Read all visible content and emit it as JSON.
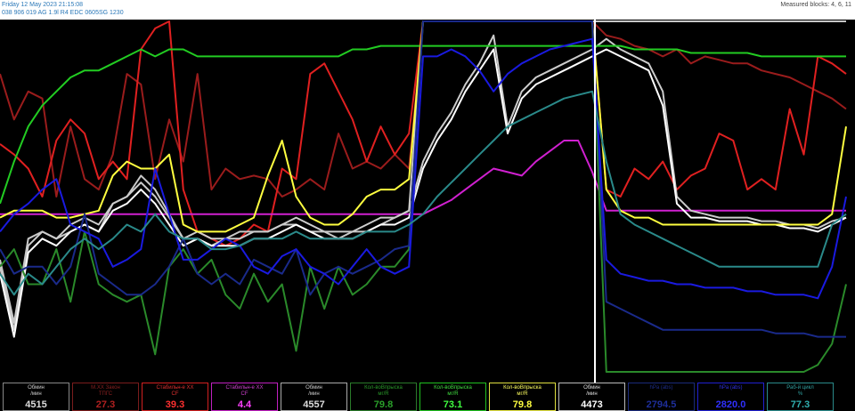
{
  "header": {
    "line1": "Friday 12 May 2023 21:15:08",
    "line2": "038 906 019 AG  1.9l R4 EDC 0605SG  1230",
    "blocks": "Measured blocks: 4, 6, 11"
  },
  "chart_data": {
    "type": "line",
    "ylim": [
      0,
      100
    ],
    "xlim": [
      0,
      60
    ],
    "cursor_x": 42,
    "series": [
      {
        "color": "#9a1c1c",
        "values": [
          85,
          72,
          80,
          78,
          50,
          70,
          55,
          52,
          62,
          85,
          82,
          55,
          72,
          60,
          85,
          52,
          58,
          55,
          56,
          55,
          50,
          52,
          55,
          52,
          68,
          58,
          60,
          58,
          62,
          58,
          100,
          100,
          100,
          100,
          100,
          100,
          100,
          100,
          100,
          100,
          100,
          100,
          100,
          96,
          95,
          93,
          92,
          90,
          92,
          88,
          90,
          89,
          88,
          88,
          86,
          85,
          84,
          82,
          80,
          78,
          75
        ]
      },
      {
        "color": "#e02020",
        "values": [
          65,
          62,
          58,
          50,
          66,
          72,
          68,
          55,
          60,
          55,
          92,
          98,
          100,
          52,
          40,
          38,
          36,
          38,
          42,
          40,
          58,
          55,
          85,
          88,
          80,
          72,
          60,
          70,
          62,
          68,
          100,
          100,
          100,
          100,
          100,
          100,
          100,
          100,
          100,
          100,
          100,
          100,
          100,
          52,
          50,
          58,
          55,
          60,
          52,
          56,
          58,
          68,
          66,
          52,
          55,
          52,
          75,
          62,
          90,
          88,
          85
        ]
      },
      {
        "color": "#d020d0",
        "values": [
          45,
          45,
          45,
          45,
          45,
          45,
          45,
          45,
          45,
          45,
          45,
          45,
          45,
          45,
          45,
          45,
          45,
          45,
          45,
          45,
          45,
          45,
          45,
          45,
          45,
          45,
          45,
          45,
          45,
          45,
          45,
          47,
          49,
          52,
          55,
          58,
          57,
          56,
          60,
          63,
          66,
          66,
          57,
          46,
          46,
          46,
          46,
          46,
          46,
          46,
          46,
          46,
          46,
          46,
          46,
          46,
          46,
          46,
          46,
          46,
          46
        ]
      },
      {
        "color": "#c8c8c8",
        "values": [
          32,
          14,
          38,
          40,
          38,
          40,
          42,
          40,
          48,
          50,
          56,
          52,
          45,
          38,
          38,
          36,
          38,
          40,
          40,
          40,
          42,
          42,
          40,
          40,
          38,
          40,
          40,
          42,
          44,
          46,
          100,
          100,
          100,
          100,
          100,
          100,
          100,
          100,
          100,
          100,
          100,
          100,
          100,
          100,
          100,
          100,
          100,
          100,
          100,
          100,
          100,
          100,
          100,
          100,
          100,
          100,
          100,
          100,
          100,
          100,
          100
        ]
      },
      {
        "color": "#cccccc",
        "values": [
          30,
          12,
          36,
          40,
          38,
          42,
          44,
          42,
          48,
          50,
          54,
          50,
          44,
          38,
          40,
          38,
          38,
          38,
          40,
          40,
          42,
          44,
          42,
          40,
          40,
          40,
          42,
          44,
          44,
          46,
          60,
          68,
          74,
          82,
          88,
          96,
          70,
          80,
          84,
          86,
          88,
          90,
          92,
          95,
          92,
          90,
          88,
          80,
          50,
          46,
          45,
          44,
          44,
          44,
          43,
          43,
          42,
          42,
          41,
          43,
          44
        ]
      },
      {
        "color": "#ffffff",
        "values": [
          28,
          10,
          34,
          38,
          36,
          40,
          42,
          40,
          46,
          48,
          52,
          48,
          42,
          36,
          38,
          36,
          36,
          36,
          38,
          38,
          40,
          42,
          40,
          38,
          38,
          38,
          40,
          42,
          42,
          44,
          58,
          66,
          72,
          80,
          86,
          92,
          68,
          78,
          82,
          84,
          86,
          88,
          90,
          92,
          90,
          88,
          86,
          76,
          48,
          44,
          44,
          43,
          43,
          43,
          42,
          42,
          41,
          41,
          40,
          42,
          44
        ]
      },
      {
        "color": "#2a8a2a",
        "values": [
          30,
          35,
          25,
          25,
          35,
          20,
          40,
          25,
          22,
          20,
          22,
          5,
          30,
          35,
          28,
          32,
          22,
          18,
          28,
          20,
          25,
          6,
          30,
          18,
          30,
          22,
          25,
          30,
          30,
          35,
          100,
          100,
          100,
          100,
          100,
          100,
          100,
          100,
          100,
          100,
          100,
          100,
          100,
          0,
          0,
          0,
          0,
          0,
          0,
          0,
          0,
          0,
          0,
          0,
          0,
          0,
          0,
          0,
          2,
          8,
          25
        ]
      },
      {
        "color": "#22cc22",
        "values": [
          48,
          60,
          70,
          76,
          80,
          84,
          86,
          86,
          88,
          90,
          92,
          90,
          92,
          92,
          90,
          90,
          90,
          90,
          90,
          90,
          90,
          90,
          90,
          90,
          90,
          92,
          92,
          93,
          93,
          93,
          93,
          93,
          93,
          93,
          93,
          93,
          93,
          93,
          93,
          93,
          93,
          93,
          93,
          93,
          93,
          92,
          92,
          92,
          92,
          91,
          91,
          91,
          91,
          91,
          90,
          90,
          90,
          90,
          90,
          90,
          90
        ]
      },
      {
        "color": "#ffff40",
        "values": [
          44,
          46,
          46,
          46,
          44,
          44,
          45,
          46,
          56,
          60,
          58,
          58,
          62,
          42,
          40,
          40,
          40,
          42,
          44,
          56,
          66,
          50,
          44,
          42,
          42,
          45,
          50,
          52,
          52,
          55,
          100,
          100,
          100,
          100,
          100,
          100,
          100,
          100,
          100,
          100,
          100,
          100,
          100,
          52,
          46,
          44,
          44,
          42,
          42,
          42,
          42,
          42,
          42,
          42,
          42,
          42,
          42,
          42,
          42,
          45,
          70
        ]
      },
      {
        "color": "#1a2a8a",
        "values": [
          35,
          28,
          30,
          30,
          25,
          30,
          45,
          28,
          25,
          22,
          22,
          25,
          30,
          38,
          28,
          25,
          28,
          25,
          32,
          30,
          28,
          35,
          22,
          28,
          30,
          28,
          30,
          32,
          35,
          36,
          100,
          100,
          100,
          100,
          100,
          100,
          100,
          100,
          100,
          100,
          100,
          100,
          100,
          20,
          18,
          16,
          14,
          12,
          12,
          12,
          12,
          12,
          12,
          12,
          12,
          11,
          11,
          11,
          10,
          10,
          10
        ]
      },
      {
        "color": "#1a1ae0",
        "values": [
          40,
          45,
          48,
          52,
          55,
          42,
          40,
          38,
          30,
          32,
          35,
          58,
          45,
          32,
          32,
          35,
          38,
          36,
          30,
          28,
          33,
          35,
          30,
          28,
          25,
          30,
          35,
          30,
          28,
          30,
          90,
          90,
          92,
          90,
          86,
          80,
          85,
          88,
          90,
          92,
          93,
          94,
          95,
          32,
          28,
          27,
          26,
          26,
          25,
          25,
          24,
          24,
          24,
          23,
          23,
          22,
          22,
          22,
          21,
          30,
          50
        ]
      },
      {
        "color": "#2a8a8a",
        "values": [
          28,
          22,
          28,
          25,
          30,
          35,
          38,
          35,
          38,
          42,
          40,
          45,
          40,
          38,
          38,
          35,
          35,
          36,
          38,
          38,
          38,
          40,
          38,
          38,
          38,
          38,
          40,
          40,
          40,
          42,
          45,
          50,
          54,
          58,
          62,
          66,
          70,
          72,
          74,
          76,
          78,
          79,
          80,
          60,
          45,
          42,
          40,
          38,
          36,
          34,
          32,
          30,
          30,
          30,
          30,
          30,
          30,
          30,
          30,
          42,
          45
        ]
      }
    ]
  },
  "panels": [
    {
      "name": "Обмин",
      "unit": "/мин",
      "value": "4515",
      "border": "#888888",
      "name_color": "#cccccc",
      "value_color": "#dddddd"
    },
    {
      "name": "М.ХХ Закон",
      "unit": "ТПГС",
      "value": "27.3",
      "border": "#7a1c1c",
      "name_color": "#8a2020",
      "value_color": "#b02020"
    },
    {
      "name": "Стабильн-е ХХ",
      "unit": "CF",
      "value": "39.3",
      "border": "#d02020",
      "name_color": "#e03030",
      "value_color": "#ff3030"
    },
    {
      "name": "Стабильн-е ХХ",
      "unit": "CF",
      "value": "4.4",
      "border": "#c020c0",
      "name_color": "#d040d0",
      "value_color": "#ff40ff"
    },
    {
      "name": "Обмин",
      "unit": "/мин",
      "value": "4557",
      "border": "#aaaaaa",
      "name_color": "#cccccc",
      "value_color": "#dddddd"
    },
    {
      "name": "Кол-воВпрыска",
      "unit": "мг/R",
      "value": "79.8",
      "border": "#2a7a2a",
      "name_color": "#2a9a2a",
      "value_color": "#2aa02a"
    },
    {
      "name": "Кол-воВпрыска",
      "unit": "мг/R",
      "value": "73.1",
      "border": "#20c020",
      "name_color": "#40dd40",
      "value_color": "#40ff40"
    },
    {
      "name": "Кол-воВпрыска",
      "unit": "мг/R",
      "value": "79.8",
      "border": "#e0e040",
      "name_color": "#ffff60",
      "value_color": "#ffff40"
    },
    {
      "name": "Обмин",
      "unit": "/мин",
      "value": "4473",
      "border": "#bbbbbb",
      "name_color": "#dddddd",
      "value_color": "#ffffff"
    },
    {
      "name": "hPa (abs)",
      "unit": "",
      "value": "2794.5",
      "border": "#1a2a7a",
      "name_color": "#1e2e8a",
      "value_color": "#1e2e9a"
    },
    {
      "name": "hPa (abs)",
      "unit": "",
      "value": "2820.0",
      "border": "#2020d0",
      "name_color": "#3030e0",
      "value_color": "#3030ff"
    },
    {
      "name": "Раб-й цикл",
      "unit": "%",
      "value": "77.3",
      "border": "#2a8a8a",
      "name_color": "#30a0a0",
      "value_color": "#30b0b0"
    }
  ]
}
